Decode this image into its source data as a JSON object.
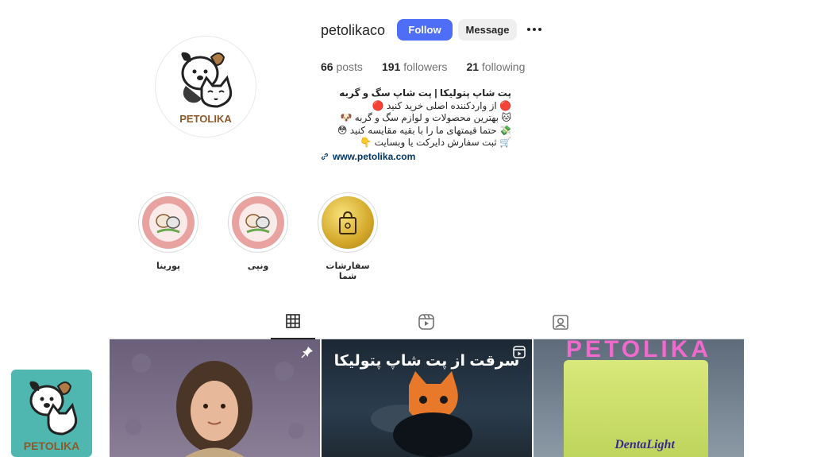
{
  "profile": {
    "username": "petolikaco",
    "follow_label": "Follow",
    "message_label": "Message",
    "avatar_text": "PETOLIKA"
  },
  "stats": {
    "posts_count": "66",
    "posts_label": "posts",
    "followers_count": "191",
    "followers_label": "followers",
    "following_count": "21",
    "following_label": "following"
  },
  "bio": {
    "name": "پت شاپ پتولیکا | پت شاپ سگ و گربه",
    "lines": [
      "🔴 از واردکننده اصلی خرید کنید 🔴",
      "🐱 بهترین محصولات و لوازم سگ و گربه 🐶",
      "💸 حتما قیمتهای ما را با بقیه مقایسه کنید 😳",
      "🛒 ثبت سفارش دایرکت یا وبسایت 👇"
    ],
    "link": "www.petolika.com"
  },
  "highlights": [
    {
      "label": "پورینا"
    },
    {
      "label": "ونپی"
    },
    {
      "label": "سفارشات شما"
    }
  ],
  "posts": {
    "post2_caption": "سرقت از پت شاپ پتولیکا",
    "post3_top_text": "PETOLIKA",
    "post3_package_text": "DentaLight"
  },
  "corner_logo_text": "PETOLIKA",
  "colors": {
    "follow_button": "#4f6ef7",
    "message_button": "#efefef",
    "link": "#00376b",
    "logo_brown": "#8b5a2b",
    "logo_teal": "#4fb7b0"
  },
  "icons": [
    "more-icon",
    "link-icon",
    "grid-icon",
    "reels-icon",
    "tagged-icon",
    "pin-icon",
    "reel-icon"
  ]
}
